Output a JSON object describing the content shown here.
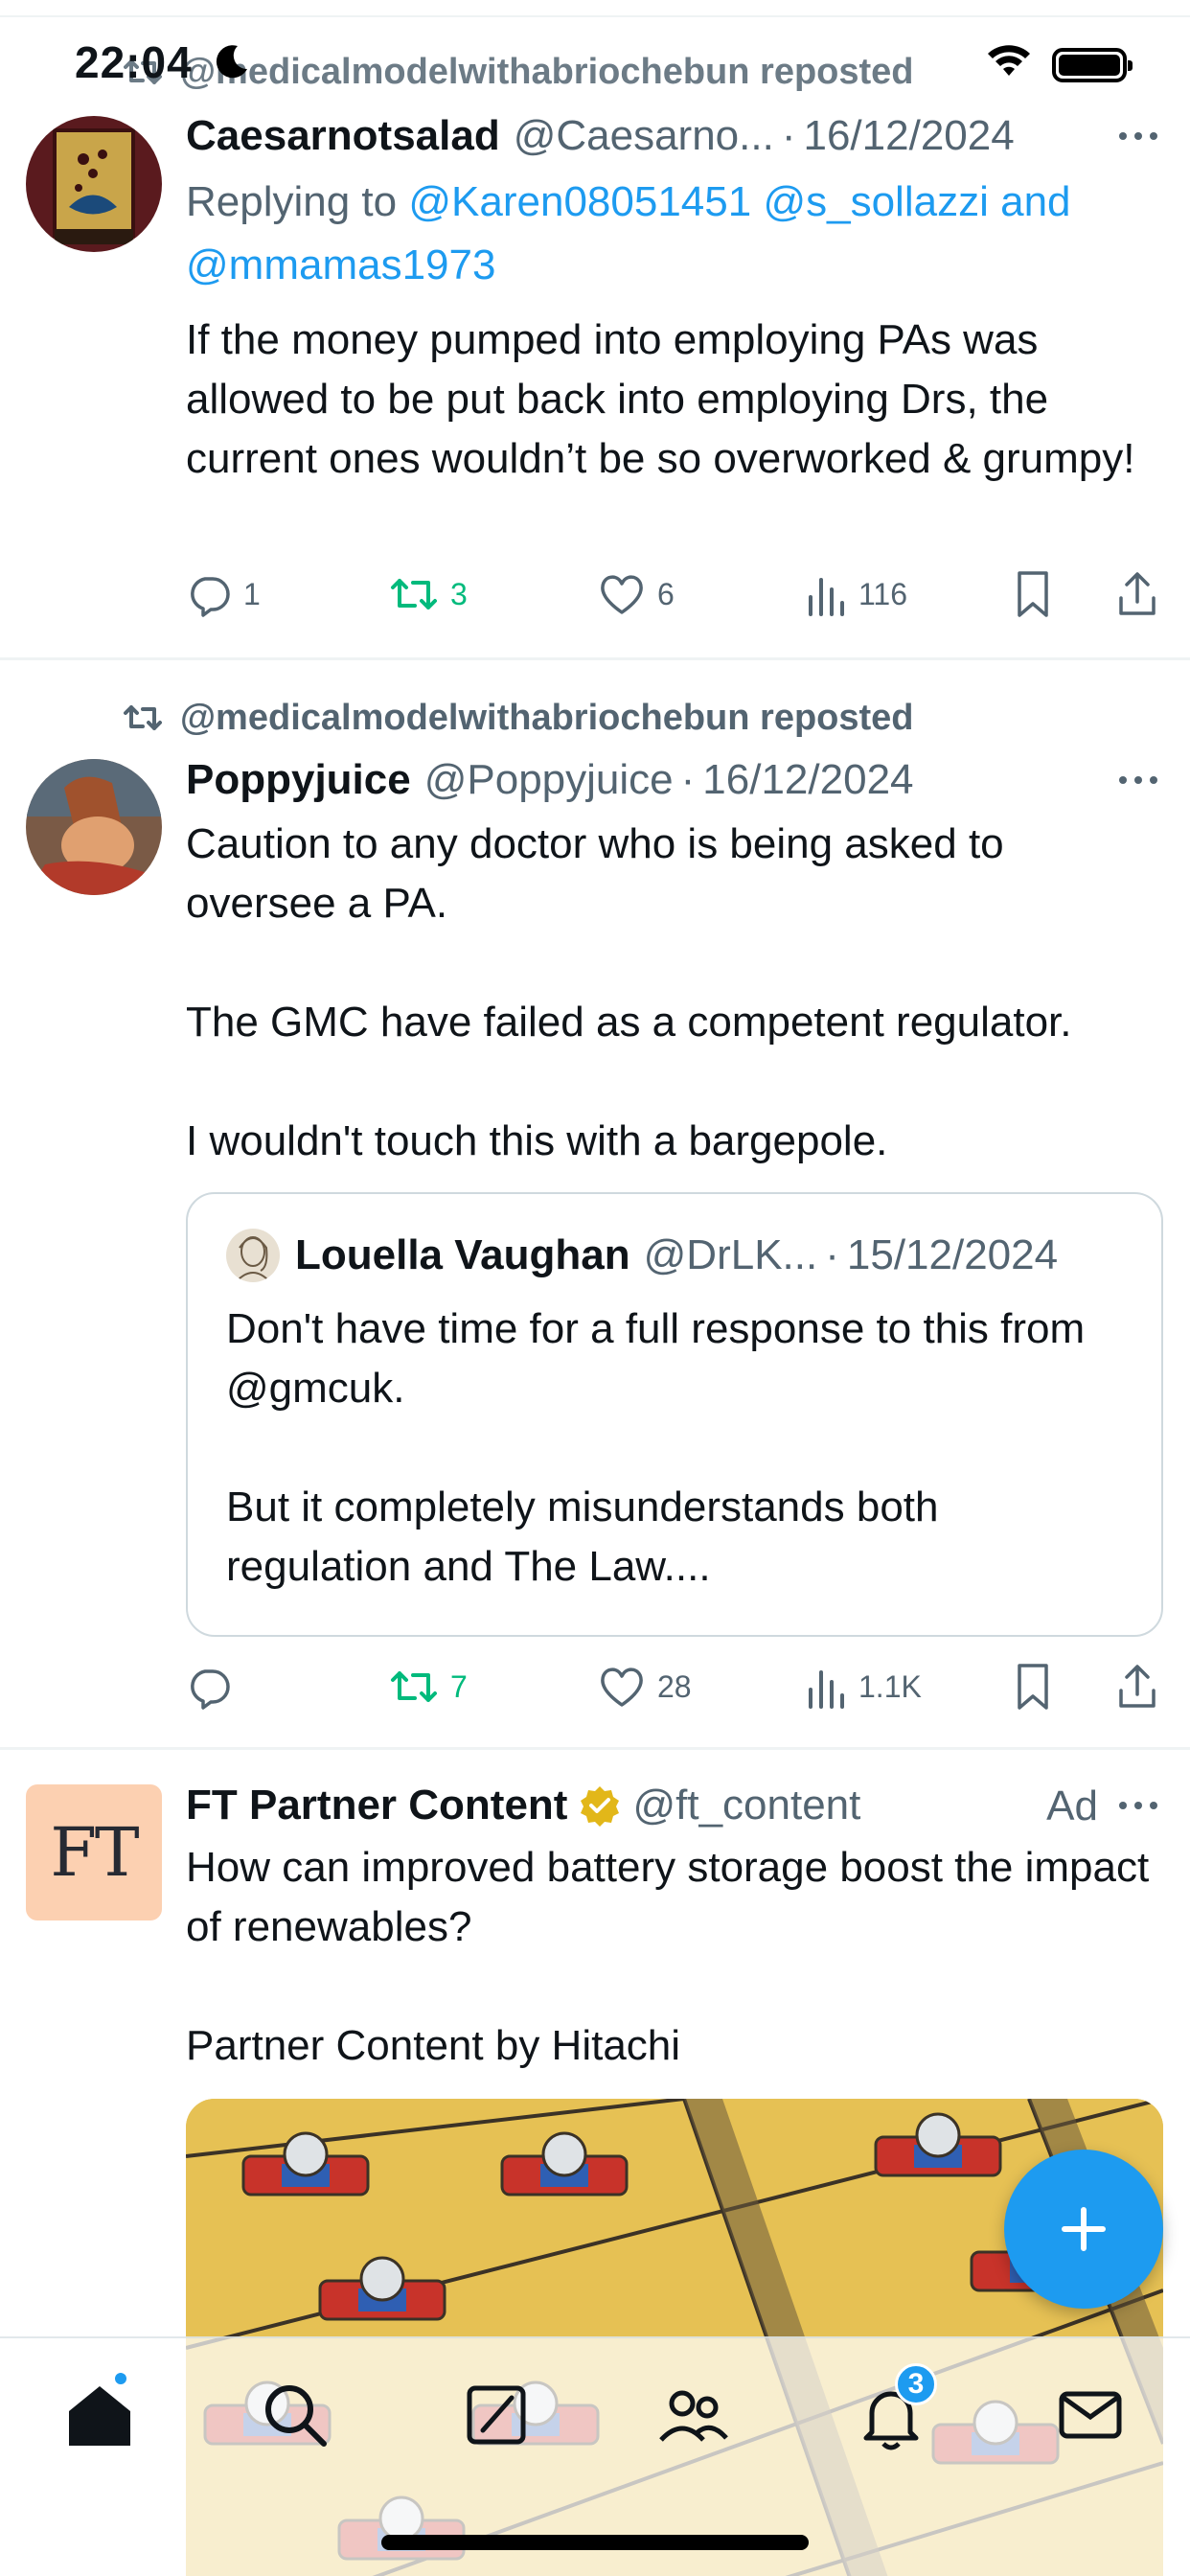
{
  "status_bar": {
    "time": "22:04"
  },
  "tweets": [
    {
      "reposted_by": "@medicalmodelwithabriochebun reposted",
      "name": "Caesarnotsalad",
      "handle": "@Caesarno...",
      "date": "16/12/2024",
      "reply_prefix": "Replying to",
      "reply_handles": [
        "@Karen08051451",
        "@s_sollazzi",
        "and",
        "@mmamas1973"
      ],
      "text": "If the money pumped into employing PAs was allowed to be put back into employing Drs, the current ones wouldn’t be so overworked & grumpy!",
      "replies": "1",
      "reposts": "3",
      "likes": "6",
      "views": "116"
    },
    {
      "reposted_by": "@medicalmodelwithabriochebun reposted",
      "name": "Poppyjuice",
      "handle": "@Poppyjuice",
      "date": "16/12/2024",
      "text": "Caution to any doctor who is being asked to oversee a PA.\n\nThe GMC have failed as a competent regulator.\n\nI wouldn't touch this with a bargepole.",
      "quote": {
        "name": "Louella Vaughan",
        "handle": "@DrLK...",
        "date": "15/12/2024",
        "text": "Don't have time for a full response to this from @gmcuk.\n\nBut it completely misunderstands both regulation and The Law...."
      },
      "replies": "",
      "reposts": "7",
      "likes": "28",
      "views": "1.1K"
    },
    {
      "avatar_text": "FT",
      "name": "FT Partner Content",
      "handle": "@ft_content",
      "ad_label": "Ad",
      "text": "How can improved battery storage boost the impact of renewables?\n\nPartner Content by Hitachi"
    }
  ],
  "tab_bar": {
    "notifications_badge": "3"
  },
  "colors": {
    "accent": "#1d9bf0",
    "repost_green": "#00ba7c",
    "secondary_text": "#536471",
    "ad_avatar_bg": "#fcd0b1"
  },
  "icons": [
    "moon-icon",
    "wifi-icon",
    "battery-icon",
    "repost-icon",
    "more-icon",
    "reply-icon",
    "like-icon",
    "views-icon",
    "bookmark-icon",
    "share-icon",
    "verified-icon",
    "compose-plus-icon",
    "home-icon",
    "search-icon",
    "grok-icon",
    "communities-icon",
    "notifications-icon",
    "messages-icon"
  ]
}
